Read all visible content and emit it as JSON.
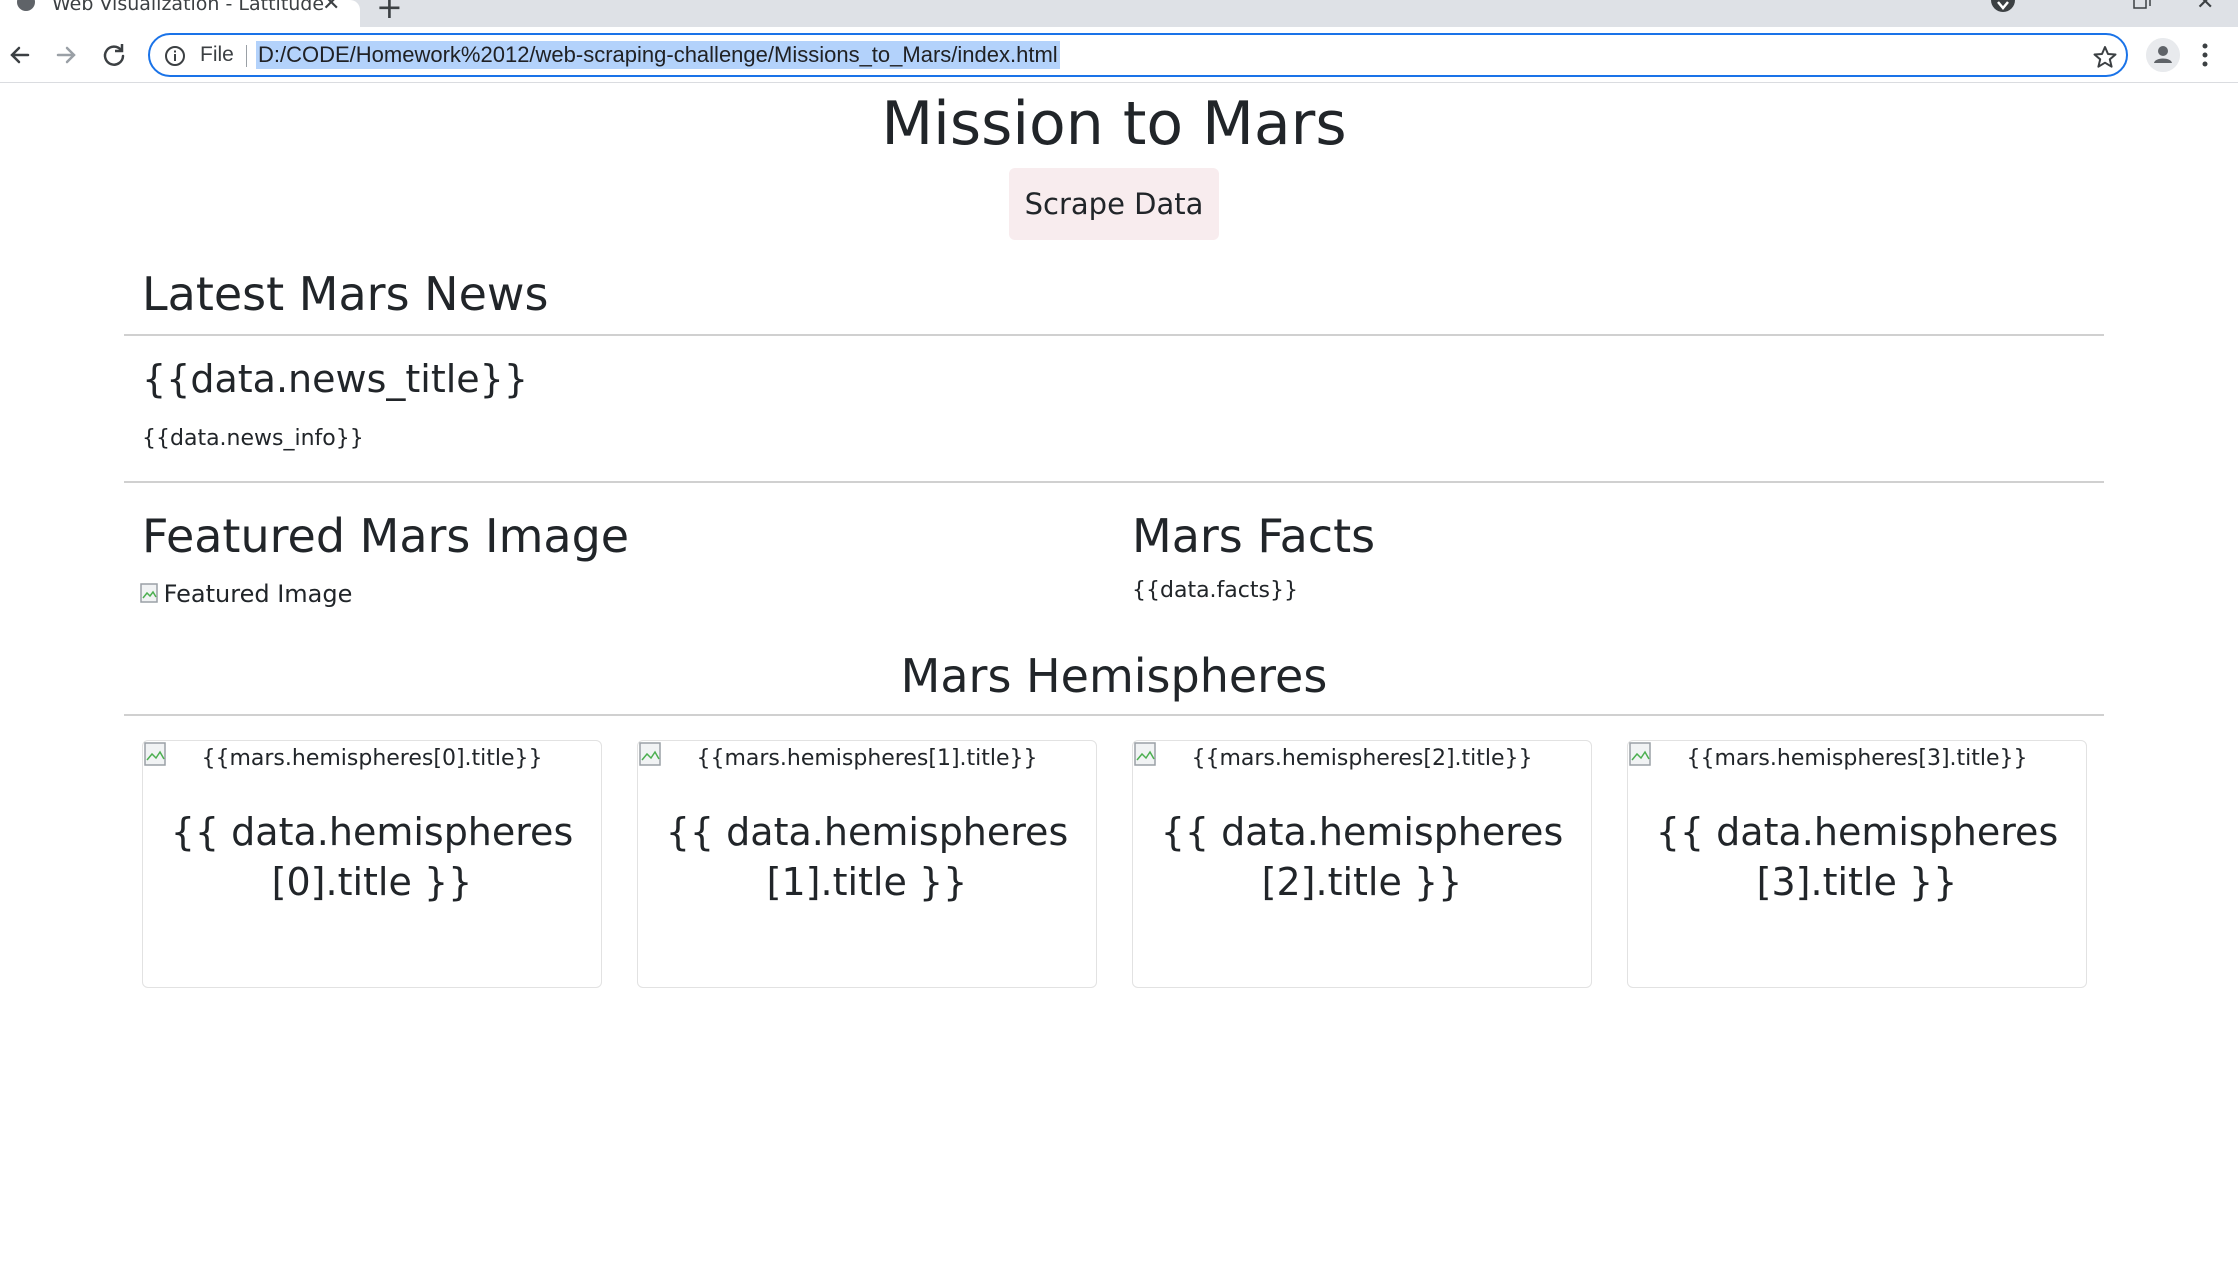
{
  "browser": {
    "tab_title": "Web Visualization - Lattitude",
    "address_scheme_label": "File",
    "url": "D:/CODE/Homework%2012/web-scraping-challenge/Missions_to_Mars/index.html"
  },
  "page": {
    "title": "Mission to Mars",
    "scrape_button_label": "Scrape Data",
    "news": {
      "heading": "Latest Mars News",
      "title": "{{data.news_title}}",
      "info": "{{data.news_info}}"
    },
    "featured": {
      "heading": "Featured Mars Image",
      "image_alt": "Featured Image"
    },
    "facts": {
      "heading": "Mars Facts",
      "text": "{{data.facts}}"
    },
    "hemispheres": {
      "heading": "Mars Hemispheres",
      "cards": [
        {
          "image_alt": "{{mars.hemispheres[0].title}}",
          "title": "{{ data.hemispheres[0].title }}"
        },
        {
          "image_alt": "{{mars.hemispheres[1].title}}",
          "title": "{{ data.hemispheres[1].title }}"
        },
        {
          "image_alt": "{{mars.hemispheres[2].title}}",
          "title": "{{ data.hemispheres[2].title }}"
        },
        {
          "image_alt": "{{mars.hemispheres[3].title}}",
          "title": "{{ data.hemispheres[3].title }}"
        }
      ]
    }
  },
  "colors": {
    "omnibox_border": "#1a73e8",
    "url_selection": "#b3d2fb",
    "button_bg": "#f8ecee",
    "text": "#212529"
  }
}
